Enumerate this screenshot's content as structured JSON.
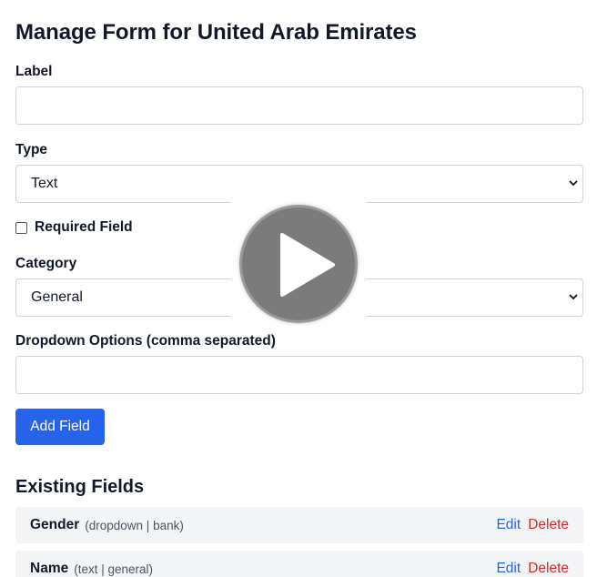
{
  "header": {
    "title": "Manage Form for United Arab Emirates"
  },
  "form": {
    "label_label": "Label",
    "label_value": "",
    "type_label": "Type",
    "type_value": "Text",
    "required_label": "Required Field",
    "required_checked": false,
    "category_label": "Category",
    "category_value": "General",
    "options_label": "Dropdown Options (comma separated)",
    "options_value": "",
    "add_button": "Add Field"
  },
  "existing": {
    "title": "Existing Fields",
    "rows": [
      {
        "name": "Gender",
        "meta": "(dropdown | bank)",
        "edit": "Edit",
        "delete": "Delete"
      },
      {
        "name": "Name",
        "meta": "(text | general)",
        "edit": "Edit",
        "delete": "Delete"
      }
    ]
  },
  "icons": {
    "select_arrow": "chevron-down-icon",
    "video": "play-icon"
  },
  "colors": {
    "primary": "#2563eb",
    "danger": "#dc2626",
    "row_bg": "#f3f4f6"
  }
}
